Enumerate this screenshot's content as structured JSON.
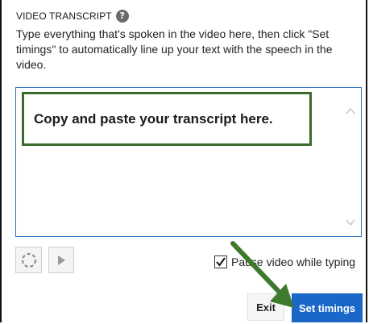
{
  "panel": {
    "title": "VIDEO TRANSCRIPT",
    "help_icon": "help-icon",
    "instructions": "Type everything that's spoken in the video here, then click \"Set timings\" to automatically line up your text with the speech in the video."
  },
  "transcript": {
    "value": "",
    "callout_text": "Copy and paste your transcript here."
  },
  "controls": {
    "refresh_icon": "refresh-icon",
    "play_icon": "play-icon",
    "pause_label": "Pause video while typing",
    "pause_checked": true
  },
  "actions": {
    "exit_label": "Exit",
    "set_timings_label": "Set timings"
  },
  "colors": {
    "accent": "#1a67c7",
    "callout_border": "#3a6b2a",
    "annotation_arrow": "#3e7a2e"
  }
}
